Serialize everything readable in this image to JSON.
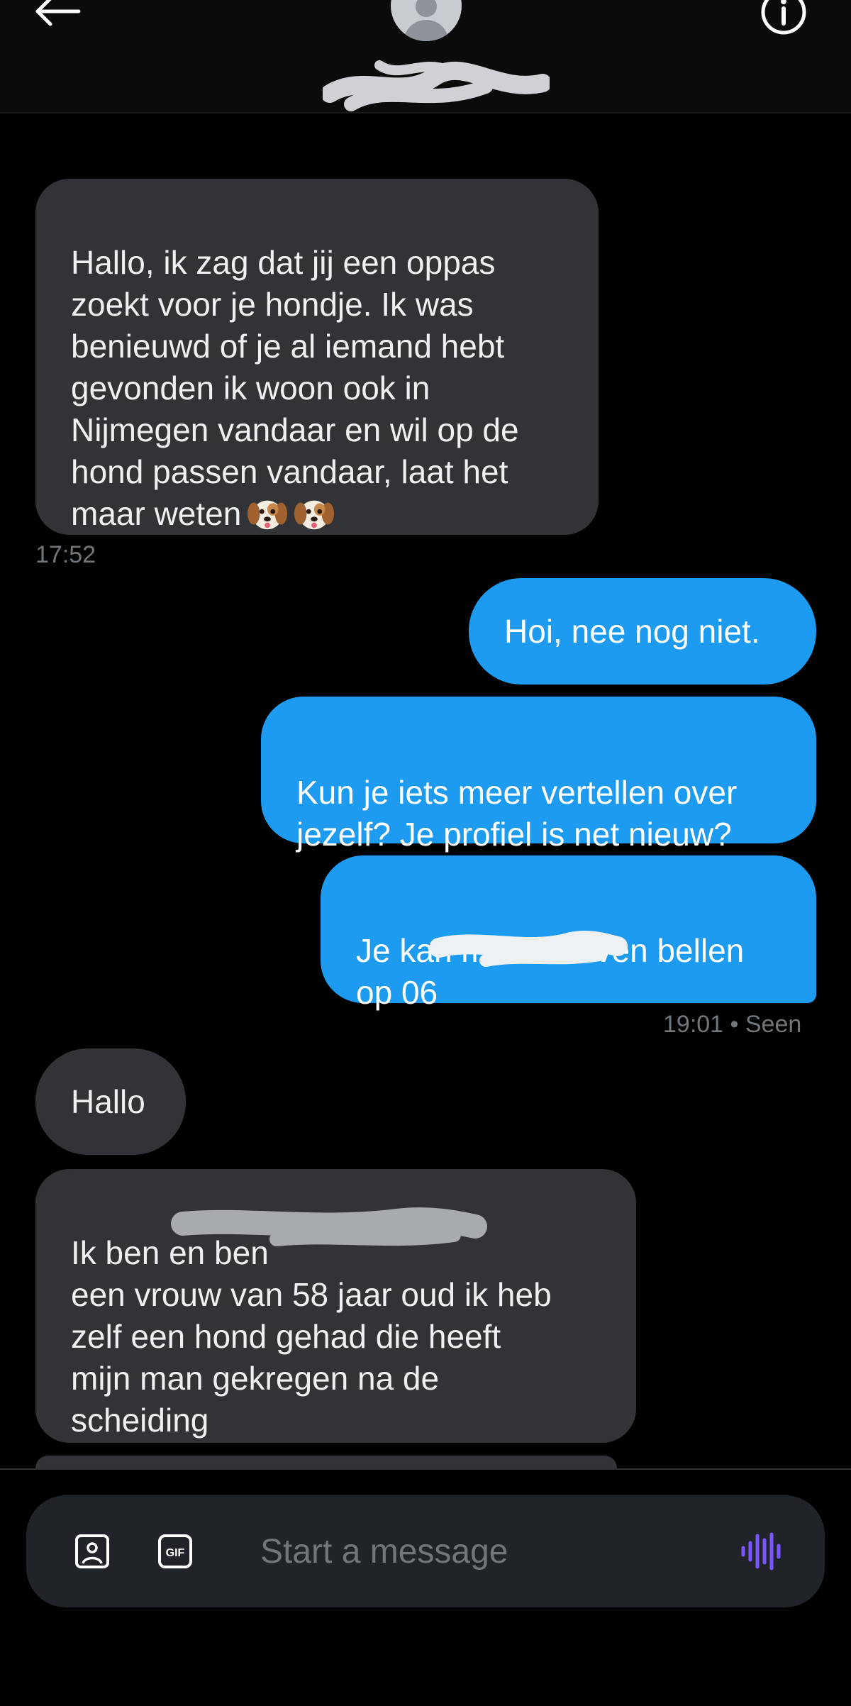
{
  "header": {
    "back_icon": "arrow-left-icon",
    "avatar_icon": "default-avatar-icon",
    "info_icon": "info-circle-icon"
  },
  "messages": [
    {
      "direction": "incoming",
      "text": "Hallo, ik zag dat jij een oppas\nzoekt voor je hondje. Ik was\nbenieuwd of je al iemand hebt\ngevonden ik woon ook in\nNijmegen vandaar en wil op de\nhond passen vandaar, laat het\nmaar weten",
      "emoji": [
        "dog-face-emoji",
        "dog-face-emoji"
      ],
      "time": "17:52"
    },
    {
      "direction": "outgoing",
      "text": "Hoi, nee nog niet."
    },
    {
      "direction": "outgoing",
      "text": "Kun je iets meer vertellen over\njezelf? Je profiel is net nieuw?"
    },
    {
      "direction": "outgoing",
      "text": "Je kan me ook even bellen\nop 06",
      "time": "19:01 • Seen"
    },
    {
      "direction": "incoming",
      "text": "Hallo"
    },
    {
      "direction": "incoming",
      "text": "Ik ben                                    en ben\neen vrouw van 58 jaar oud ik heb\nzelf een hond gehad die heeft\nmijn man gekregen na de\nscheiding"
    }
  ],
  "composer": {
    "placeholder": "Start a message",
    "media_icon": "image-icon",
    "gif_icon": "gif-icon",
    "gif_label": "GIF",
    "voice_icon": "voice-waveform-icon"
  },
  "colors": {
    "background": "#000000",
    "incoming_bubble": "#313336",
    "outgoing_bubble": "#1d9bf0",
    "timestamp": "#71767b",
    "voice_accent": "#7856ff"
  }
}
